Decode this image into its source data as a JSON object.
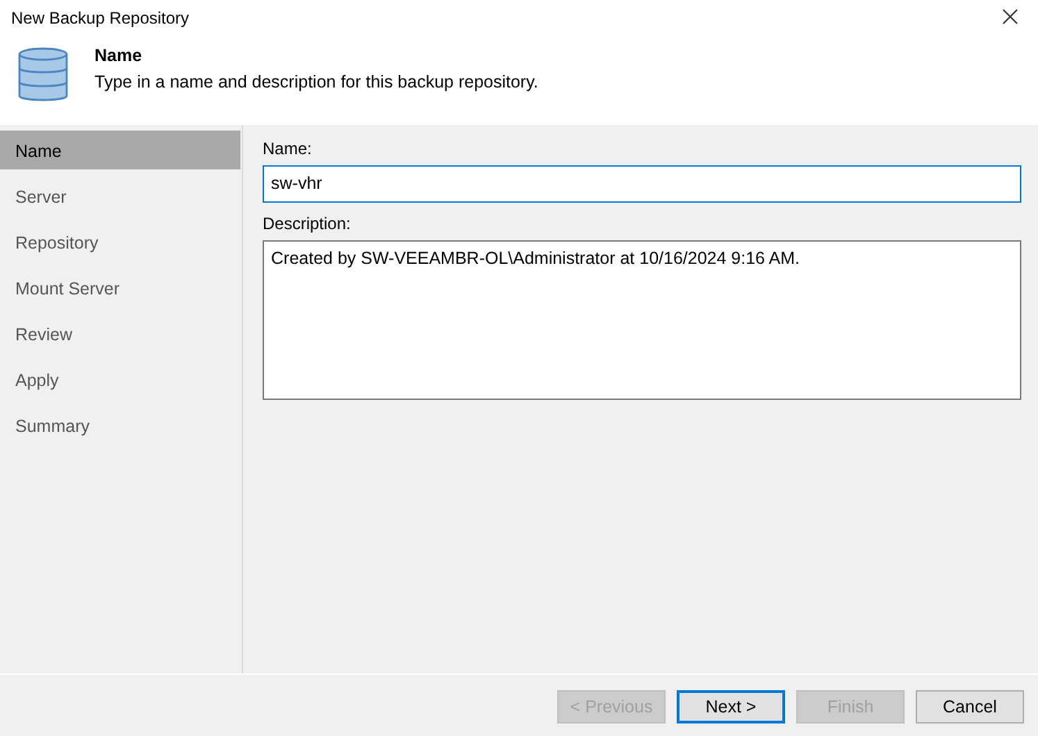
{
  "window": {
    "title": "New Backup Repository"
  },
  "header": {
    "title": "Name",
    "subtitle": "Type in a name and description for this backup repository."
  },
  "steps": [
    {
      "label": "Name",
      "selected": true
    },
    {
      "label": "Server",
      "selected": false
    },
    {
      "label": "Repository",
      "selected": false
    },
    {
      "label": "Mount Server",
      "selected": false
    },
    {
      "label": "Review",
      "selected": false
    },
    {
      "label": "Apply",
      "selected": false
    },
    {
      "label": "Summary",
      "selected": false
    }
  ],
  "form": {
    "name_label": "Name:",
    "name_value": "sw-vhr",
    "description_label": "Description:",
    "description_value": "Created by SW-VEEAMBR-OL\\Administrator at 10/16/2024 9:16 AM."
  },
  "buttons": [
    {
      "label": "< Previous",
      "disabled": true,
      "default": false
    },
    {
      "label": "Next >",
      "disabled": false,
      "default": true
    },
    {
      "label": "Finish",
      "disabled": true,
      "default": false
    },
    {
      "label": "Cancel",
      "disabled": false,
      "default": false
    }
  ]
}
